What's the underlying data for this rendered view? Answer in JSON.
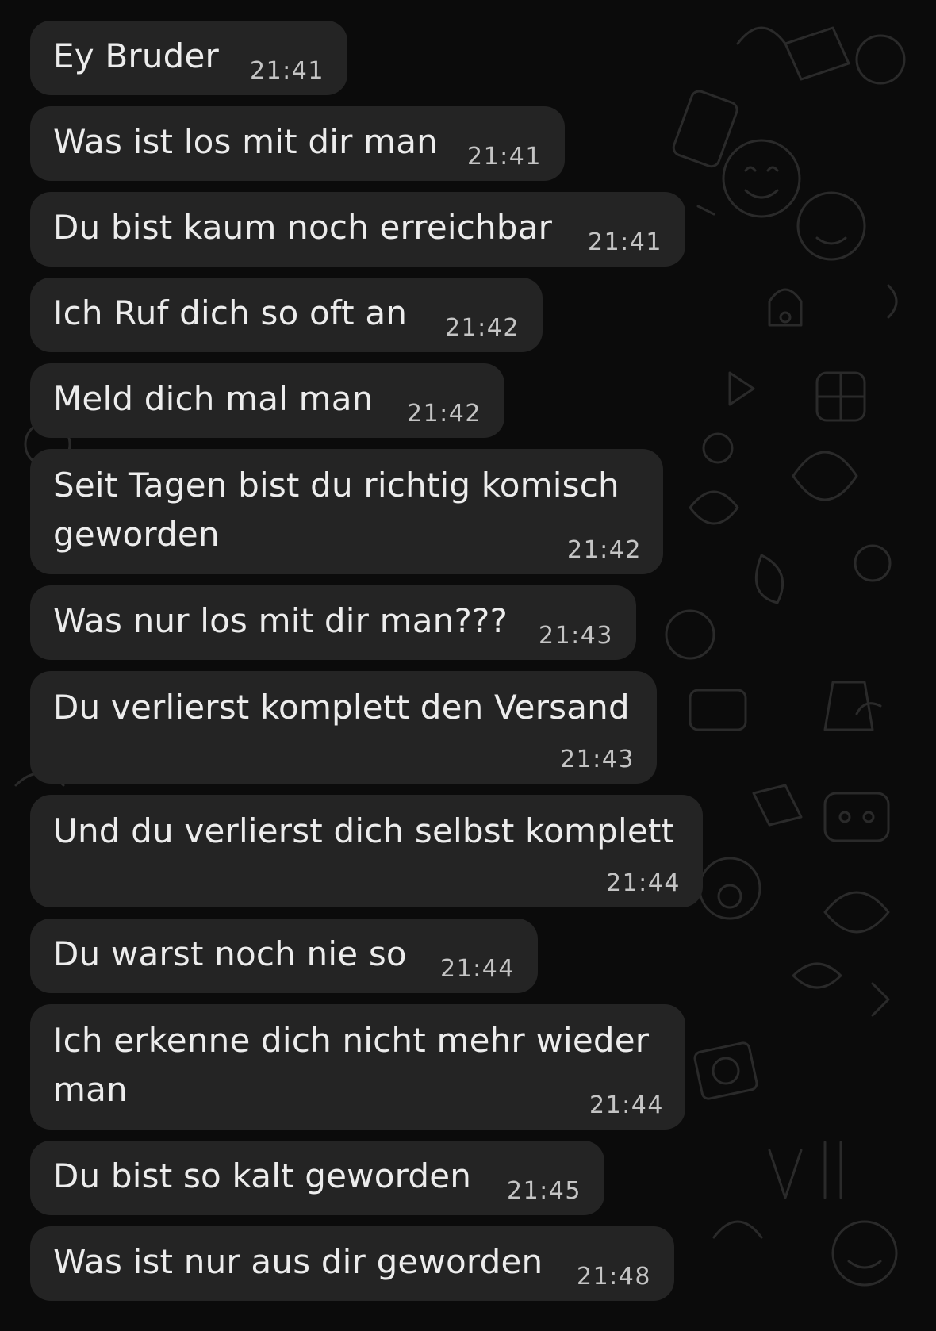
{
  "conversation": {
    "messages": [
      {
        "text": "Ey Bruder",
        "time": "21:41"
      },
      {
        "text": "Was ist los mit dir man",
        "time": "21:41"
      },
      {
        "text": "Du bist kaum noch erreichbar",
        "time": "21:41"
      },
      {
        "text": "Ich Ruf dich so oft an",
        "time": "21:42"
      },
      {
        "text": "Meld dich mal man",
        "time": "21:42"
      },
      {
        "text": "Seit Tagen bist du richtig komisch",
        "text2": "geworden",
        "time": "21:42"
      },
      {
        "text": "Was nur los mit dir man???",
        "time": "21:43"
      },
      {
        "text": "Du verlierst komplett den Versand",
        "time": "21:43"
      },
      {
        "text": "Und du verlierst dich selbst komplett",
        "time": "21:44"
      },
      {
        "text": "Du warst noch nie so",
        "time": "21:44"
      },
      {
        "text": "Ich erkenne dich nicht mehr wieder",
        "text2": "man",
        "time": "21:44"
      },
      {
        "text": "Du bist so kalt geworden",
        "time": "21:45"
      },
      {
        "text": "Was ist nur aus dir geworden",
        "time": "21:48"
      }
    ]
  },
  "theme": {
    "background": "#0b0b0b",
    "bubble_color": "#242424",
    "text_color": "#ececec",
    "time_color": "#c4c4c4",
    "wallpaper_icon_color": "#2b2b2b"
  }
}
